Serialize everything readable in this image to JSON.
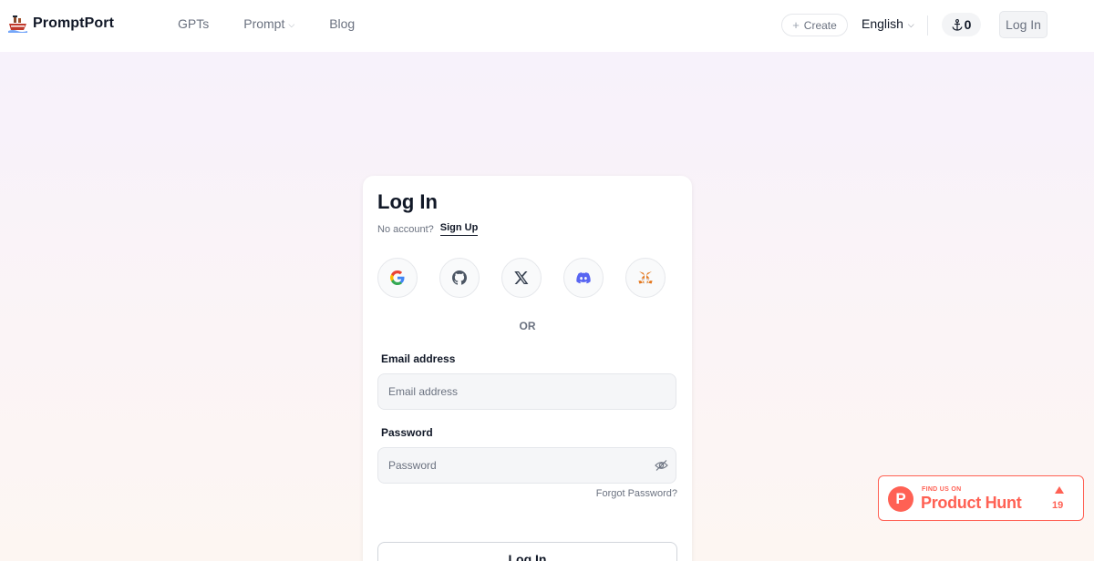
{
  "header": {
    "brand_name": "PromptPort",
    "nav": {
      "gpts": "GPTs",
      "prompt": "Prompt",
      "blog": "Blog"
    },
    "create_label": "Create",
    "language": "English",
    "points": "0",
    "login_label": "Log In"
  },
  "login_card": {
    "title": "Log In",
    "no_account_text": "No account?",
    "signup_link": "Sign Up",
    "social_buttons": [
      "google-icon",
      "github-icon",
      "x-icon",
      "discord-icon",
      "metamask-icon"
    ],
    "or_text": "OR",
    "email": {
      "label": "Email address",
      "placeholder": "Email address",
      "value": ""
    },
    "password": {
      "label": "Password",
      "placeholder": "Password",
      "value": ""
    },
    "forgot_password": "Forgot Password?",
    "submit_label": "Log In"
  },
  "product_hunt": {
    "small_text": "FIND US ON",
    "big_text": "Product Hunt",
    "votes": "19"
  },
  "colors": {
    "product_hunt": "#ff6154",
    "text_primary": "#111827",
    "text_secondary": "#6b7280"
  }
}
